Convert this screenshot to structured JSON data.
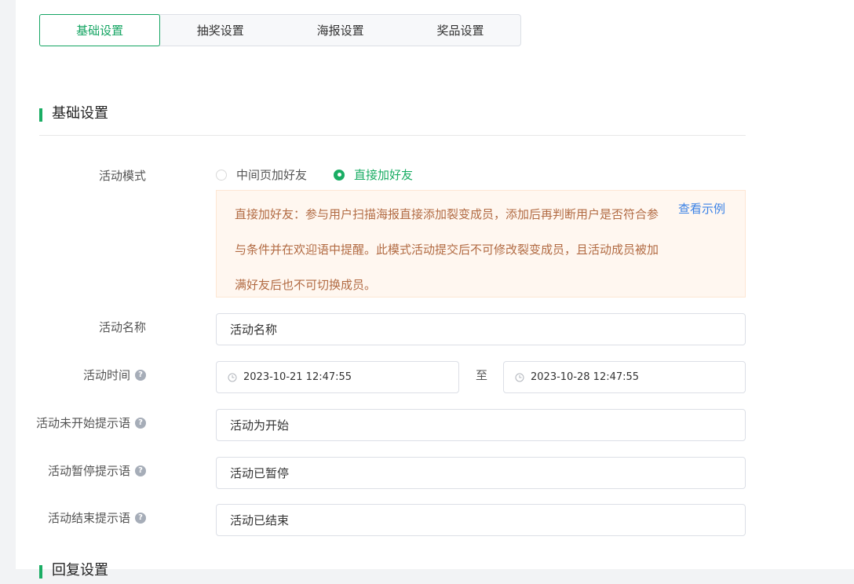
{
  "tabs": [
    {
      "label": "基础设置",
      "active": true
    },
    {
      "label": "抽奖设置",
      "active": false
    },
    {
      "label": "海报设置",
      "active": false
    },
    {
      "label": "奖品设置",
      "active": false
    }
  ],
  "section": {
    "title": "基础设置",
    "next_title": "回复设置"
  },
  "form": {
    "mode": {
      "label": "活动模式",
      "options": [
        "中间页加好友",
        "直接加好友"
      ],
      "selected": "直接加好友"
    },
    "notice": {
      "text": "直接加好友：参与用户扫描海报直接添加裂变成员，添加后再判断用户是否符合参与条件并在欢迎语中提醒。此模式活动提交后不可修改裂变成员，且活动成员被加满好友后也不可切换成员。",
      "link": "查看示例"
    },
    "name": {
      "label": "活动名称",
      "value": "活动名称"
    },
    "time": {
      "label": "活动时间",
      "start": "2023-10-21 12:47:55",
      "separator": "至",
      "end": "2023-10-28 12:47:55"
    },
    "not_started_tip": {
      "label": "活动未开始提示语",
      "value": "活动为开始"
    },
    "paused_tip": {
      "label": "活动暂停提示语",
      "value": "活动已暂停"
    },
    "ended_tip": {
      "label": "活动结束提示语",
      "value": "活动已结束"
    }
  },
  "colors": {
    "accent": "#1aad64",
    "notice_text": "#b26b43",
    "notice_bg": "#fff7f0",
    "link": "#3b82e6"
  }
}
